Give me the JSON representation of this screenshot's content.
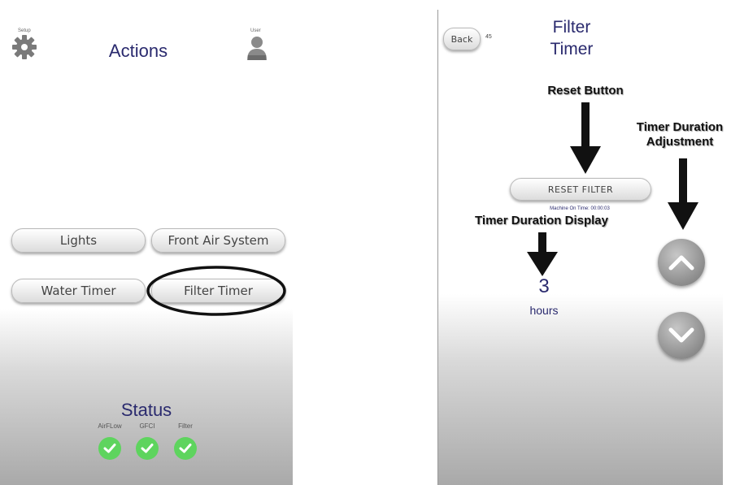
{
  "left": {
    "setup_label": "Setup",
    "user_label": "User",
    "title": "Actions",
    "buttons": {
      "lights": "Lights",
      "front_air": "Front Air System",
      "water_timer": "Water Timer",
      "filter_timer": "Filter Timer"
    },
    "status": {
      "title": "Status",
      "items": [
        "AirFLow",
        "GFCI",
        "Filter"
      ]
    }
  },
  "right": {
    "back_label": "Back",
    "back_count": "45",
    "title_line1": "Filter",
    "title_line2": "Timer",
    "reset_button": "RESET FILTER",
    "machine_on_time": "Machine On Time: 00:00:03",
    "timer_value": "3",
    "timer_unit": "hours"
  },
  "annotations": {
    "reset_button": "Reset Button",
    "timer_duration_adjustment_line1": "Timer Duration",
    "timer_duration_adjustment_line2": "Adjustment",
    "timer_duration_display": "Timer Duration Display"
  },
  "colors": {
    "title_color": "#2a2a6e",
    "status_ok": "#5ed45e"
  },
  "icons": {
    "setup": "gear-icon",
    "user": "user-icon",
    "status": "check-icon",
    "up": "chevron-up-icon",
    "down": "chevron-down-icon"
  }
}
